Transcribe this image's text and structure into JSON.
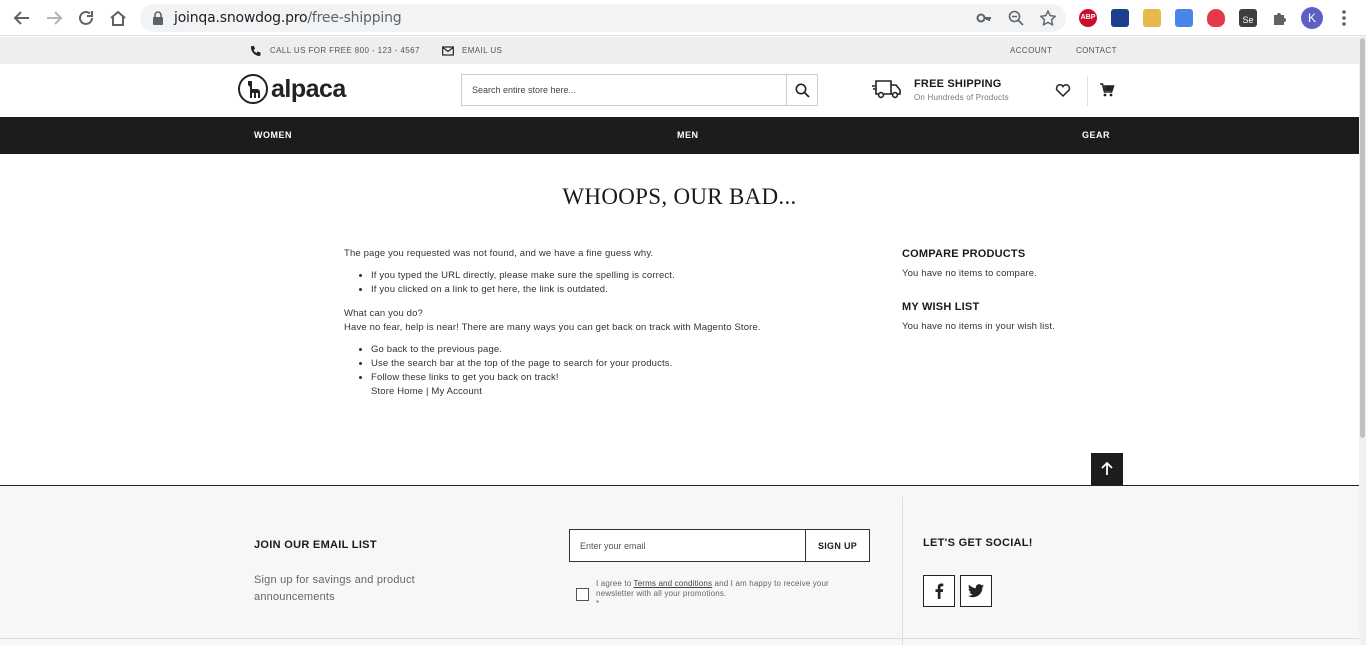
{
  "browser": {
    "url_host": "joinqa.snowdog.pro",
    "url_path": "/free-shipping",
    "profile_initial": "K",
    "extensions": [
      {
        "name": "adblock-plus-icon",
        "color": "#c8102e",
        "label": "ABP"
      },
      {
        "name": "extension-1-icon",
        "color": "#1d3f91"
      },
      {
        "name": "extension-2-icon",
        "color": "#e7b84a"
      },
      {
        "name": "google-translate-icon",
        "color": "#4a86e8"
      },
      {
        "name": "shield-extension-icon",
        "color": "#e5394b"
      },
      {
        "name": "selenium-icon",
        "color": "#3d3d3d",
        "label": "Se"
      }
    ]
  },
  "topbar": {
    "call_label": "CALL US FOR FREE 800 - 123 - 4567",
    "email_label": "EMAIL US",
    "account_label": "ACCOUNT",
    "contact_label": "CONTACT"
  },
  "header": {
    "logo_text": "alpaca",
    "search_placeholder": "Search entire store here...",
    "shipping_title": "FREE SHIPPING",
    "shipping_subtitle": "On Hundreds of Products"
  },
  "nav": {
    "women": "WOMEN",
    "men": "MEN",
    "gear": "GEAR"
  },
  "main": {
    "title": "WHOOPS, OUR BAD...",
    "intro": "The page you requested was not found, and we have a fine guess why.",
    "reasons": [
      "If you typed the URL directly, please make sure the spelling is correct.",
      "If you clicked on a link to get here, the link is outdated."
    ],
    "what_can_you_do": "What can you do?",
    "help_text": "Have no fear, help is near! There are many ways you can get back on track with Magento Store.",
    "actions": [
      "Go back to the previous page.",
      "Use the search bar at the top of the page to search for your products.",
      "Follow these links to get you back on track!"
    ],
    "link_store_home": "Store Home",
    "link_separator": "|",
    "link_my_account": "My Account"
  },
  "sidebar": {
    "compare_title": "COMPARE PRODUCTS",
    "compare_text": "You have no items to compare.",
    "wishlist_title": "MY WISH LIST",
    "wishlist_text": "You have no items in your wish list."
  },
  "footer": {
    "join_title": "JOIN OUR EMAIL LIST",
    "join_text": "Sign up for savings and product announcements",
    "email_placeholder": "Enter your email",
    "signup_label": "SIGN UP",
    "agree_prefix": "I agree to",
    "agree_terms": "Terms and conditions",
    "agree_suffix": "and I am happy to receive your newsletter with all your promotions.",
    "required_mark": "*",
    "social_title": "LET'S GET SOCIAL!"
  }
}
